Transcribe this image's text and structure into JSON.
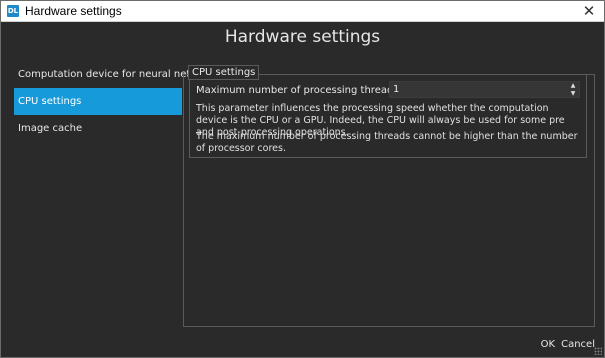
{
  "window": {
    "title": "Hardware settings",
    "app_icon_text": "DL",
    "close_glyph": "✕"
  },
  "heading": "Hardware settings",
  "sidebar": {
    "items": [
      {
        "label": "Computation device for neural network"
      },
      {
        "label": "CPU settings",
        "selected": true
      },
      {
        "label": "Image cache"
      }
    ]
  },
  "cpu_settings": {
    "group_title": "CPU settings",
    "threads_label": "Maximum number of processing threads:",
    "threads_value": "1",
    "description_1": "This parameter influences the processing speed whether the computation device is the CPU or a GPU. Indeed, the CPU will always be used for some pre and post-processing operations.",
    "description_2": "The maximum number of processing threads cannot be higher than the number of processor cores."
  },
  "footer": {
    "ok_label": "OK",
    "cancel_label": "Cancel"
  },
  "colors": {
    "background": "#2a2a2a",
    "accent": "#169ad9",
    "text": "#e8e8e8"
  }
}
